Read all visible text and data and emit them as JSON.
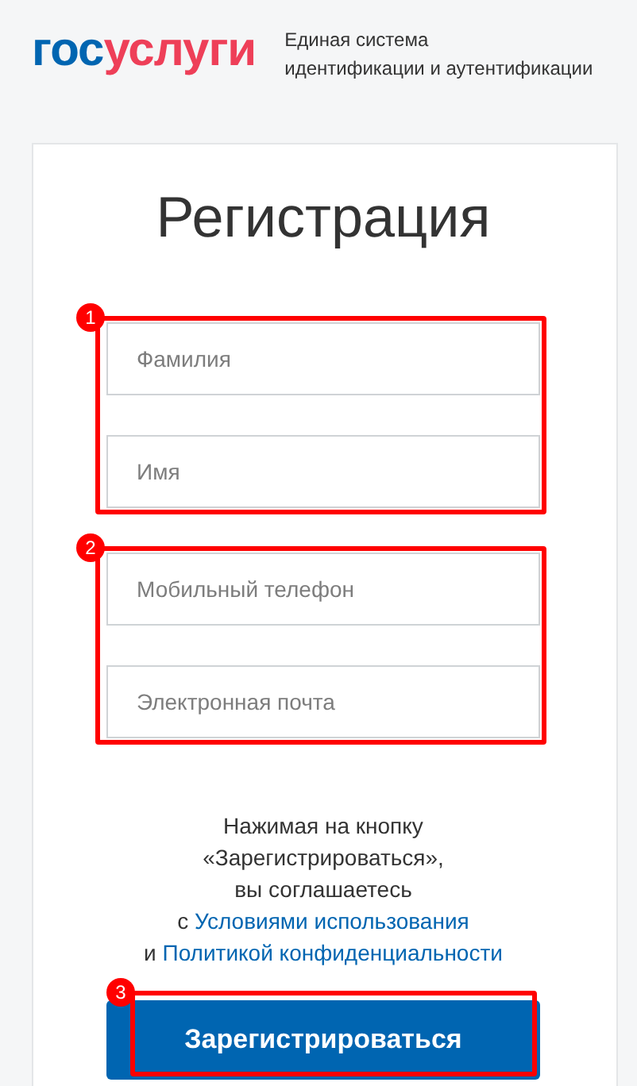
{
  "header": {
    "logo": {
      "part_1": "гос",
      "part_2": "услуги"
    },
    "tagline_lines": [
      "Единая система",
      "идентификации и аутентификации"
    ]
  },
  "form": {
    "title": "Регистрация",
    "field_groups": [
      {
        "marker": "1",
        "fields": [
          {
            "placeholder": "Фамилия"
          },
          {
            "placeholder": "Имя"
          }
        ]
      },
      {
        "marker": "2",
        "fields": [
          {
            "placeholder": "Мобильный телефон"
          },
          {
            "placeholder": "Электронная почта"
          }
        ]
      }
    ],
    "consent_lines": [
      {
        "text": "Нажимая на кнопку"
      },
      {
        "text": "«Зарегистрироваться»,"
      },
      {
        "text": "вы соглашаетесь"
      },
      {
        "text": "с ",
        "link": "Условиями использования"
      },
      {
        "text": "и ",
        "link": "Политикой конфиденциальности"
      }
    ],
    "submit": {
      "label": "Зарегистрироваться",
      "marker": "3"
    }
  }
}
